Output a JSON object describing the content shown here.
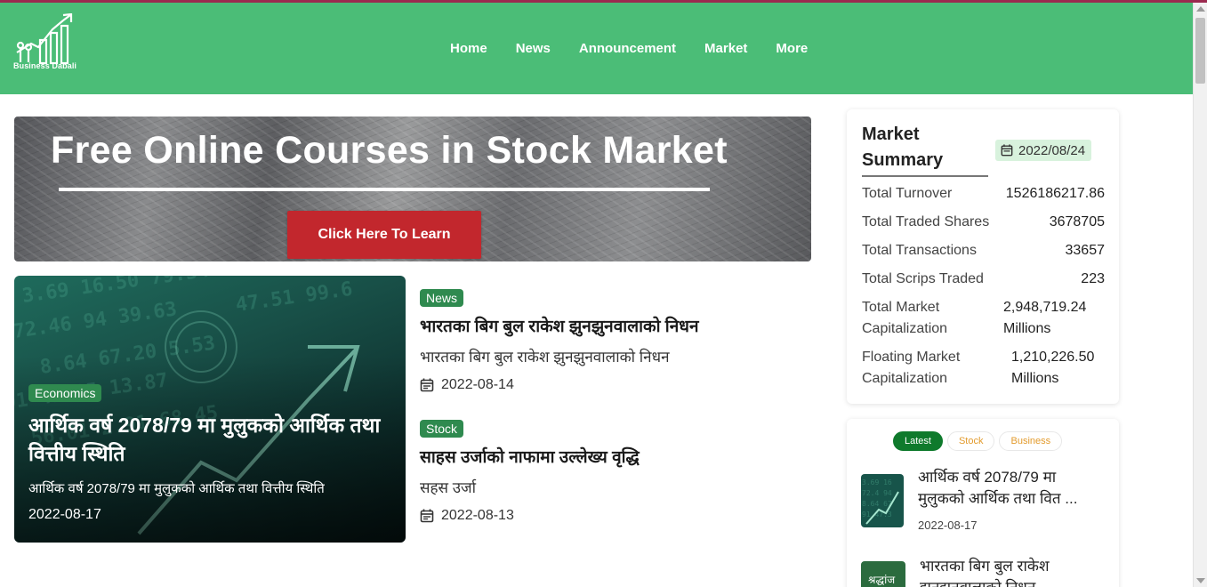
{
  "brand": {
    "name": "Business Dabali"
  },
  "nav": {
    "items": [
      "Home",
      "News",
      "Announcement",
      "Market",
      "More"
    ]
  },
  "banner": {
    "title": "Free Online Courses in Stock Market",
    "button": "Click Here To Learn"
  },
  "feature": {
    "badge": "Economics",
    "title": "आर्थिक वर्ष 2078/79 मा मुलुकको आर्थिक तथा वित्तीय स्थिति",
    "subtitle": "आर्थिक वर्ष 2078/79 मा मुलुकको आर्थिक तथा वित्तीय स्थिति",
    "date": "2022-08-17"
  },
  "news_list": [
    {
      "badge": "News",
      "title": "भारतका बिग बुल राकेश झुनझुनवालाको निधन",
      "subtitle": "भारतका बिग बुल राकेश झुनझुनवालाको निधन",
      "date": "2022-08-14"
    },
    {
      "badge": "Stock",
      "title": "साहस उर्जाको नाफामा उल्लेख्य वृद्धि",
      "subtitle": "सहस उर्जा",
      "date": "2022-08-13"
    }
  ],
  "market_summary": {
    "title_line1": "Market",
    "title_line2": "Summary",
    "date": "2022/08/24",
    "rows": [
      {
        "label": "Total Turnover",
        "value": "1526186217.86"
      },
      {
        "label": "Total Traded Shares",
        "value": "3678705"
      },
      {
        "label": "Total Transactions",
        "value": "33657"
      },
      {
        "label": "Total Scrips Traded",
        "value": "223"
      }
    ],
    "cap_rows": [
      {
        "label_line1": "Total Market",
        "label_line2": "Capitalization",
        "value_line1": "2,948,719.24",
        "value_line2": "Millions"
      },
      {
        "label_line1": "Floating Market",
        "label_line2": "Capitalization",
        "value_line1": "1,210,226.50",
        "value_line2": "Millions"
      }
    ]
  },
  "latest": {
    "tabs": [
      "Latest",
      "Stock",
      "Business"
    ],
    "items": [
      {
        "title_line1": "आर्थिक वर्ष 2078/79 मा",
        "title_line2": "मुलुकको आर्थिक तथा वित ...",
        "date": "2022-08-17"
      },
      {
        "title_line1": "भारतका बिग बुल राकेश",
        "title_line2": "झुनझुनवालाको निधन",
        "thumb_text": "श्रद्धांज"
      }
    ]
  },
  "colors": {
    "nav_bg": "#4bbd77",
    "badge": "#2f8a4f",
    "button": "#c2272d",
    "tab_active": "#0f7a2c",
    "tab_inactive_text": "#e39b2d"
  }
}
